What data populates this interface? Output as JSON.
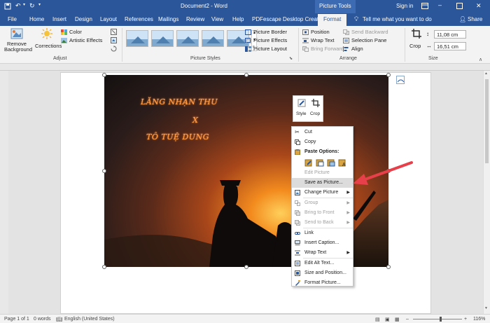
{
  "titlebar": {
    "doc_title": "Document2 - Word",
    "context_label": "Picture Tools",
    "signin": "Sign in"
  },
  "tabs": [
    "File",
    "Home",
    "Insert",
    "Design",
    "Layout",
    "References",
    "Mailings",
    "Review",
    "View",
    "Help",
    "PDFescape Desktop Creator",
    "Format"
  ],
  "active_tab": "Format",
  "tell_me": "Tell me what you want to do",
  "share": "Share",
  "ribbon": {
    "remove_background": "Remove Background",
    "corrections": "Corrections",
    "color": "Color",
    "artistic_effects": "Artistic Effects",
    "adjust_group": "Adjust",
    "picture_styles_group": "Picture Styles",
    "picture_border": "Picture Border",
    "picture_effects": "Picture Effects",
    "picture_layout": "Picture Layout",
    "position": "Position",
    "wrap_text": "Wrap Text",
    "bring_forward": "Bring Forward",
    "send_backward": "Send Backward",
    "selection_pane": "Selection Pane",
    "align": "Align",
    "arrange_group": "Arrange",
    "crop": "Crop",
    "height": "11,08 cm",
    "width": "16,51 cm",
    "size_group": "Size"
  },
  "photo_text": {
    "line1": "LĂNG NHẠN THU",
    "line2": "X",
    "line3": "TÔ TUỆ DUNG"
  },
  "mini_toolbar": {
    "style": "Style",
    "crop": "Crop"
  },
  "context_menu": {
    "cut": "Cut",
    "copy": "Copy",
    "paste_options": "Paste Options:",
    "edit_picture": "Edit Picture",
    "save_as_picture": "Save as Picture...",
    "change_picture": "Change Picture",
    "group": "Group",
    "bring_to_front": "Bring to Front",
    "send_to_back": "Send to Back",
    "link": "Link",
    "insert_caption": "Insert Caption...",
    "wrap_text": "Wrap Text",
    "edit_alt_text": "Edit Alt Text...",
    "size_and_position": "Size and Position...",
    "format_picture": "Format Picture..."
  },
  "status": {
    "page": "Page 1 of 1",
    "words": "0 words",
    "language": "English (United States)",
    "zoom": "116%"
  },
  "colors": {
    "word_blue": "#2b579a",
    "arrow_red": "#e8404a"
  }
}
